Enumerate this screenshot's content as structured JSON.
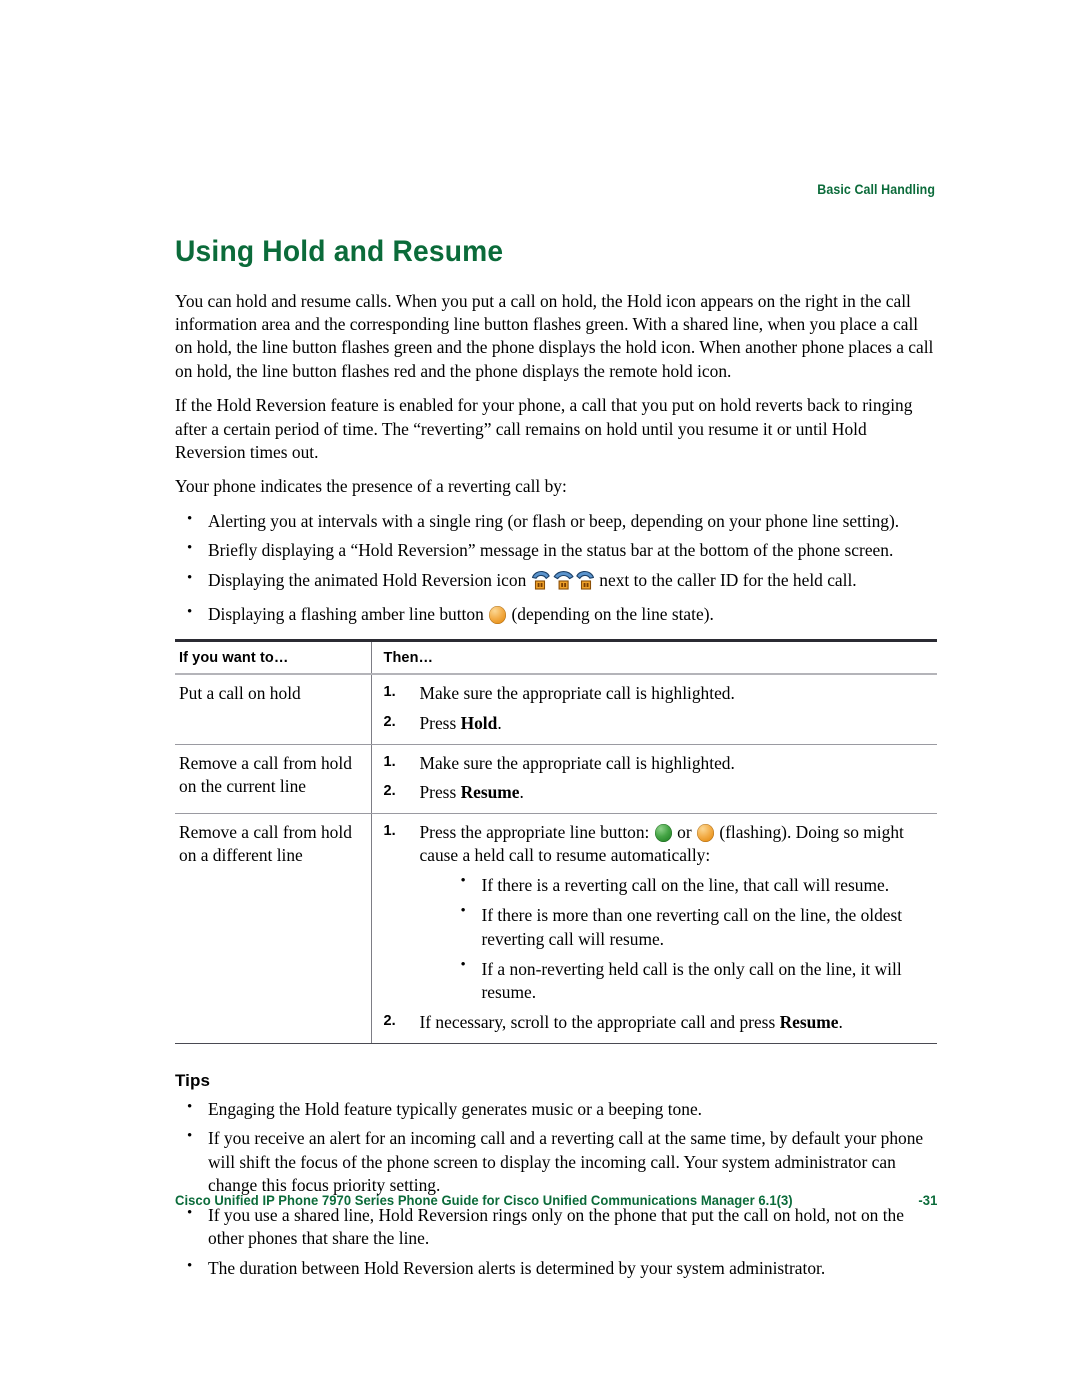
{
  "header": {
    "running_head": "Basic Call Handling"
  },
  "title": "Using Hold and Resume",
  "intro": {
    "para1": "You can hold and resume calls. When you put a call on hold, the Hold icon appears on the right in the call information area and the corresponding line button flashes green. With a shared line, when you place a call on hold, the line button flashes green and the phone displays the hold icon. When another phone places a call on hold, the line button flashes red and the phone displays the remote hold icon.",
    "para2": "If the Hold Reversion feature is enabled for your phone, a call that you put on hold reverts back to ringing after a certain period of time. The “reverting” call remains on hold until you resume it or until Hold Reversion times out.",
    "para3": "Your phone indicates the presence of a reverting call by:"
  },
  "indicators": {
    "b1": "Alerting you at intervals with a single ring (or flash or beep, depending on your phone line setting).",
    "b2": "Briefly displaying a “Hold Reversion” message in the status bar at the bottom of the phone screen.",
    "b3_pre": "Displaying the animated Hold Reversion icon",
    "b3_post": "next to the caller ID for the held call.",
    "b4_pre": "Displaying a flashing amber line button",
    "b4_post": "(depending on the line state)."
  },
  "table": {
    "headers": [
      "If you want to…",
      "Then…"
    ],
    "rows": [
      {
        "want": "Put a call on hold",
        "steps": [
          {
            "num": "1.",
            "pre": "Make sure the appropriate call is highlighted.",
            "bold": "",
            "post": ""
          },
          {
            "num": "2.",
            "pre": "Press ",
            "bold": "Hold",
            "post": "."
          }
        ]
      },
      {
        "want": "Remove a call from hold on the current line",
        "steps": [
          {
            "num": "1.",
            "pre": "Make sure the appropriate call is highlighted.",
            "bold": "",
            "post": ""
          },
          {
            "num": "2.",
            "pre": "Press ",
            "bold": "Resume",
            "post": "."
          }
        ]
      },
      {
        "want": "Remove a call from hold on a different line",
        "step1_pre": "Press the appropriate line button:",
        "step1_or": "or",
        "step1_post": "(flashing). Doing so might cause a held call to resume automatically:",
        "step1_num": "1.",
        "substeps": [
          "If there is a reverting call on the line, that call will resume.",
          "If there is more than one reverting call on the line, the oldest reverting call will resume.",
          "If a non-reverting held call is the only call on the line, it will resume."
        ],
        "step2_num": "2.",
        "step2_pre": "If necessary, scroll to the appropriate call and press ",
        "step2_bold": "Resume",
        "step2_post": "."
      }
    ]
  },
  "tips": {
    "title": "Tips",
    "items": [
      "Engaging the Hold feature typically generates music or a beeping tone.",
      "If you receive an alert for an incoming call and a reverting call at the same time, by default your phone will shift the focus of the phone screen to display the incoming call. Your system administrator can change this focus priority setting.",
      "If you use a shared line, Hold Reversion rings only on the phone that put the call on hold, not on the other phones that share the line.",
      "The duration between Hold Reversion alerts is determined by your system administrator."
    ]
  },
  "footer": {
    "doc_title": "Cisco Unified IP Phone 7970 Series Phone Guide for Cisco Unified Communications Manager 6.1(3)",
    "page_number": "-31"
  },
  "colors": {
    "brand_green": "#0B6B3A",
    "line_button_amber": "#f3ae4a",
    "line_button_green": "#46a546",
    "handset_blue": "#3f7fc1"
  }
}
